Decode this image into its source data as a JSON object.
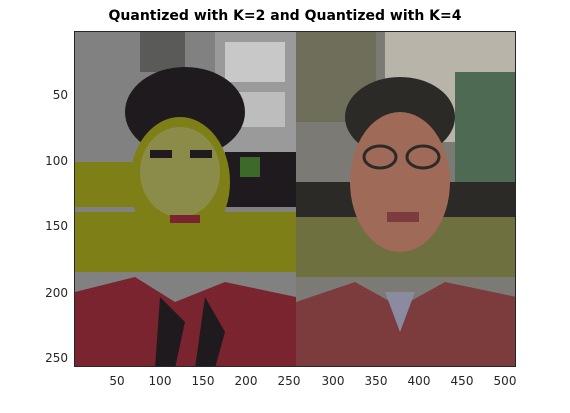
{
  "title": "Quantized with K=2 and Quantized with K=4",
  "colors": {
    "k2_gray": "#818181",
    "k2_olive": "#7f7f18",
    "k2_red": "#7a2430",
    "k2_dark": "#1e1a1e",
    "k4_gray": "#7c7a74",
    "k4_olive": "#6e7040",
    "k4_red": "#7c3c3e",
    "k4_face": "#a06a58",
    "k4_dark": "#2c2a26",
    "k4_green": "#4e6a52"
  },
  "axes": {
    "xticks": [
      "50",
      "100",
      "150",
      "200",
      "250",
      "300",
      "350",
      "400",
      "450",
      "500"
    ],
    "yticks": [
      "50",
      "100",
      "150",
      "200",
      "250"
    ]
  }
}
